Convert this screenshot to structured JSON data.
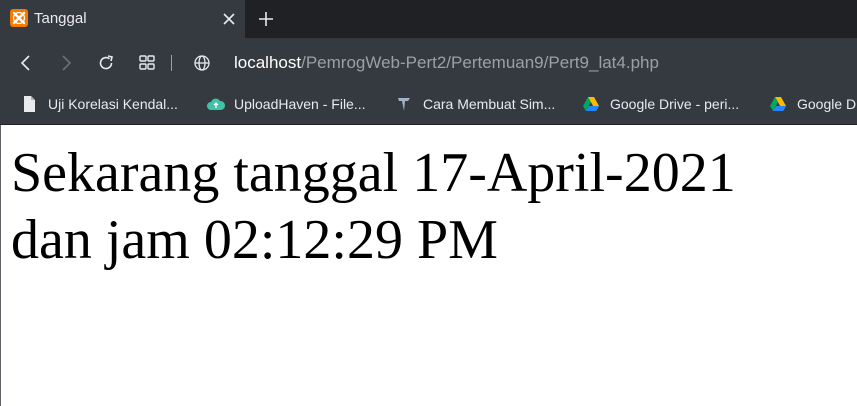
{
  "tab": {
    "title": "Tanggal",
    "favicon": "xampp-logo-icon",
    "favicon_color": "#f57900"
  },
  "address": {
    "host": "localhost",
    "path": "/PemrogWeb-Pert2/Pertemuan9/Pert9_lat4.php"
  },
  "bookmarks": [
    {
      "label": "Uji Korelasi Kendal...",
      "icon": "document-icon"
    },
    {
      "label": "UploadHaven - File...",
      "icon": "cloud-upload-icon"
    },
    {
      "label": "Cara Membuat Sim...",
      "icon": "brand-icon"
    },
    {
      "label": "Google Drive - peri...",
      "icon": "google-drive-icon"
    },
    {
      "label": "Google D",
      "icon": "google-drive-icon"
    }
  ],
  "page": {
    "line1": "Sekarang tanggal 17-April-2021",
    "line2": "dan jam 02:12:29 PM"
  },
  "colors": {
    "tabbar": "#202124",
    "toolbar": "#353a40",
    "text_light": "#e8eaed"
  }
}
